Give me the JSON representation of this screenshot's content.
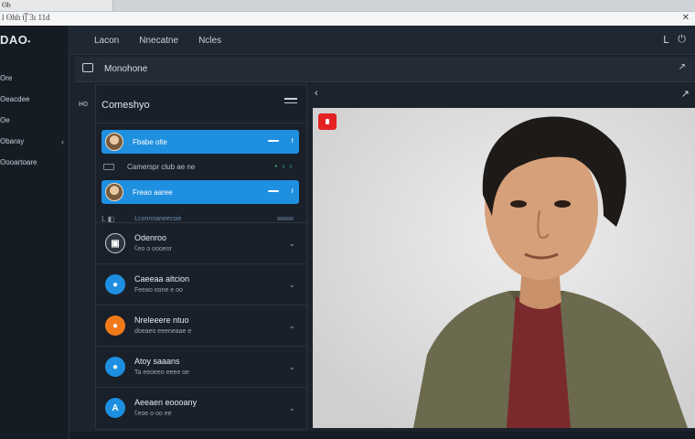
{
  "browser": {
    "tab_title": "ʘh",
    "bar_text": "l ʘhh t͡ʃ  3ı 11d",
    "close_glyph": "✕"
  },
  "app": {
    "brand": "DAO",
    "brand_suffix": "•"
  },
  "sidebar": {
    "items": [
      {
        "label": "ʘre",
        "caret": ""
      },
      {
        "label": "ʘeacdee",
        "caret": ""
      },
      {
        "label": "ʘe",
        "caret": ""
      },
      {
        "label": "ʘbaray",
        "caret": "‹"
      },
      {
        "label": "ʘooartoare",
        "caret": ""
      }
    ]
  },
  "topnav": {
    "links": [
      "Lacon",
      "Nnecatne",
      "Ncles"
    ],
    "icons": [
      "person-icon",
      "power-icon"
    ],
    "icon_glyphs": [
      "ᒪ",
      "⏻"
    ]
  },
  "toolbar": {
    "title": "Monohone",
    "end_glyph": "↗"
  },
  "panel": {
    "side_tag": "ʜo",
    "title": "Comeshyo",
    "highlighted": [
      {
        "label": "Fbabe olte",
        "mark": "ı"
      },
      {
        "label": "Freao aaree",
        "mark": "ı"
      }
    ],
    "plain_row": {
      "label": "Camerspr club ae ne",
      "dots": "• ı ı"
    },
    "thin_row": {
      "label": "Lconnnaneecsie",
      "glyph": "ᒪ ◧"
    },
    "conversations": [
      {
        "name": "Odenroo",
        "sub": "ʕeo  o oooeor",
        "avatar_letter": "▣",
        "avatar_color": "#2d3440"
      },
      {
        "name": "Caeeaa altcion",
        "sub": "Feeao  oone  e oo",
        "avatar_letter": "●",
        "avatar_color": "#1e8fe0"
      },
      {
        "name": "Nreleeere ntuo",
        "sub": "ɗoeaeo eeeneaae e",
        "avatar_letter": "●",
        "avatar_color": "#f07a1a"
      },
      {
        "name": "Atoy saaans",
        "sub": "Ta eeoeeo eeee  oe",
        "avatar_letter": "●",
        "avatar_color": "#1e8fe0"
      },
      {
        "name": "Aeeaen eoooany",
        "sub": "ʕeoe  o oo   ee",
        "avatar_letter": "A",
        "avatar_color": "#1e8fe0"
      }
    ],
    "chev": "⌄"
  },
  "video": {
    "back_glyph": "‹",
    "more_glyph": "↗",
    "subject": "portrait-person"
  }
}
